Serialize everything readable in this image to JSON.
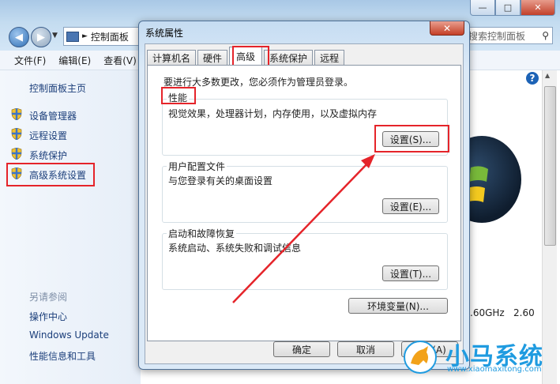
{
  "background": {
    "breadcrumb": "控制面板",
    "search_placeholder": "搜索控制面板",
    "menu": [
      "文件(F)",
      "编辑(E)",
      "查看(V)"
    ],
    "sidebar": {
      "home": "控制面板主页",
      "items": [
        "设备管理器",
        "远程设置",
        "系统保护",
        "高级系统设置"
      ],
      "see_also_title": "另请参阅",
      "see_also": [
        "操作中心",
        "Windows Update",
        "性能信息和工具"
      ]
    },
    "right_pane": {
      "cpu_freq": ".60GHz",
      "cpu_value": "2.60"
    }
  },
  "dialog": {
    "title": "系统属性",
    "tabs": [
      "计算机名",
      "硬件",
      "高级",
      "系统保护",
      "远程"
    ],
    "admin_note": "要进行大多数更改，您必须作为管理员登录。",
    "performance": {
      "title": "性能",
      "desc": "视觉效果，处理器计划，内存使用，以及虚拟内存",
      "button": "设置(S)..."
    },
    "user_profiles": {
      "title": "用户配置文件",
      "desc": "与您登录有关的桌面设置",
      "button": "设置(E)..."
    },
    "startup": {
      "title": "启动和故障恢复",
      "desc": "系统启动、系统失败和调试信息",
      "button": "设置(T)..."
    },
    "env_button": "环境变量(N)...",
    "ok": "确定",
    "cancel": "取消",
    "apply": "应用(A)"
  },
  "watermark": {
    "brand": "小马系统",
    "url": "www.xiaomaxitong.com"
  },
  "colors": {
    "highlight": "#e5242a",
    "link": "#1b3e7a",
    "titlebar": "#c4dcf0",
    "brand": "#1f9be0"
  }
}
